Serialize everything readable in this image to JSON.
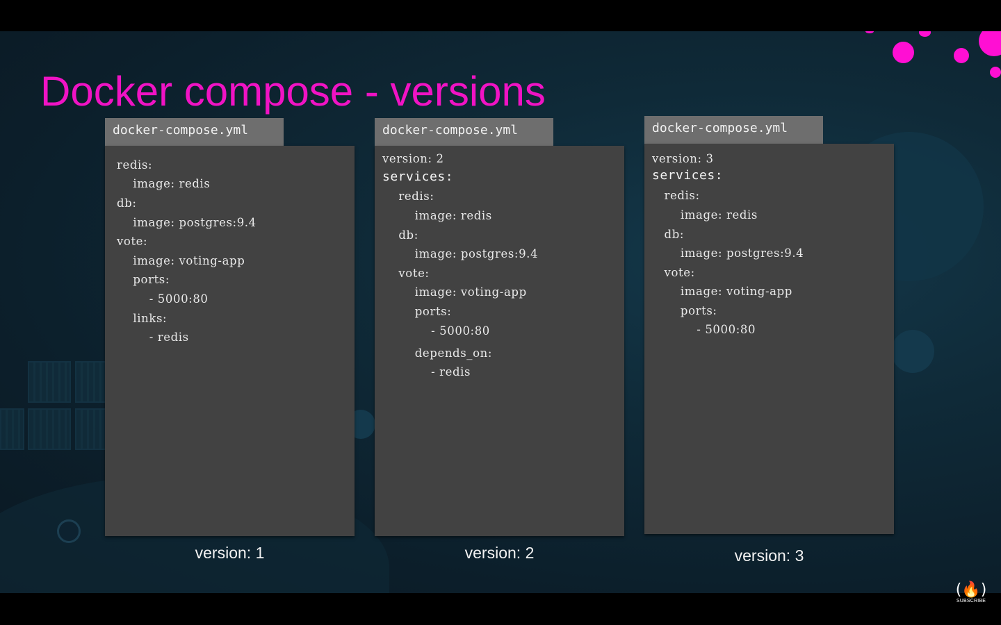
{
  "slide": {
    "title": "Docker compose - versions",
    "accent_color": "#f013c4",
    "panels": [
      {
        "filename": "docker-compose.yml",
        "lines": [
          "redis:",
          "    image: redis",
          "db:",
          "    image: postgres:9.4",
          "vote:",
          "    image: voting-app",
          "    ports:",
          "        - 5000:80",
          "    links:",
          "        - redis"
        ],
        "version_label": "version: 1"
      },
      {
        "filename": "docker-compose.yml",
        "lines": [
          "version: 2",
          "services:",
          "    redis:",
          "        image: redis",
          "    db:",
          "        image: postgres:9.4",
          "    vote:",
          "        image: voting-app",
          "        ports:",
          "            - 5000:80",
          "        depends_on:",
          "            - redis"
        ],
        "version_label": "version: 2"
      },
      {
        "filename": "docker-compose.yml",
        "lines": [
          "version: 3",
          "services:",
          "   redis:",
          "       image: redis",
          "   db:",
          "       image: postgres:9.4",
          "   vote:",
          "       image: voting-app",
          "       ports:",
          "           - 5000:80"
        ],
        "version_label": "version: 3"
      }
    ]
  },
  "overlay": {
    "subscribe_icon": "freecodecamp-logo-icon",
    "subscribe_logo": "(🔥)",
    "subscribe_text": "SUBSCRIBE"
  }
}
